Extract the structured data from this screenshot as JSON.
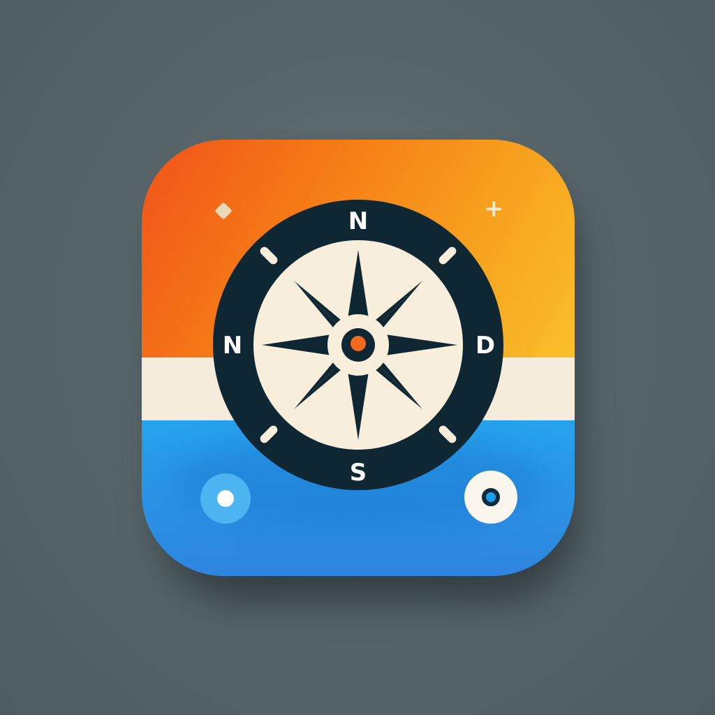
{
  "compass": {
    "north": "N",
    "west": "N",
    "east": "D",
    "south": "S"
  },
  "icons": {
    "left_button": "location-dot-icon",
    "right_button": "target-icon",
    "sparkle_left": "sparkle-icon",
    "sparkle_right": "plus-sparkle-icon"
  },
  "sparkle_plus": "+",
  "colors": {
    "background": "#566468",
    "orange": "#f57a16",
    "cream": "#f5ecdc",
    "blue": "#2b90e4",
    "dark": "#0f2633",
    "accent_center": "#f26a1b"
  }
}
